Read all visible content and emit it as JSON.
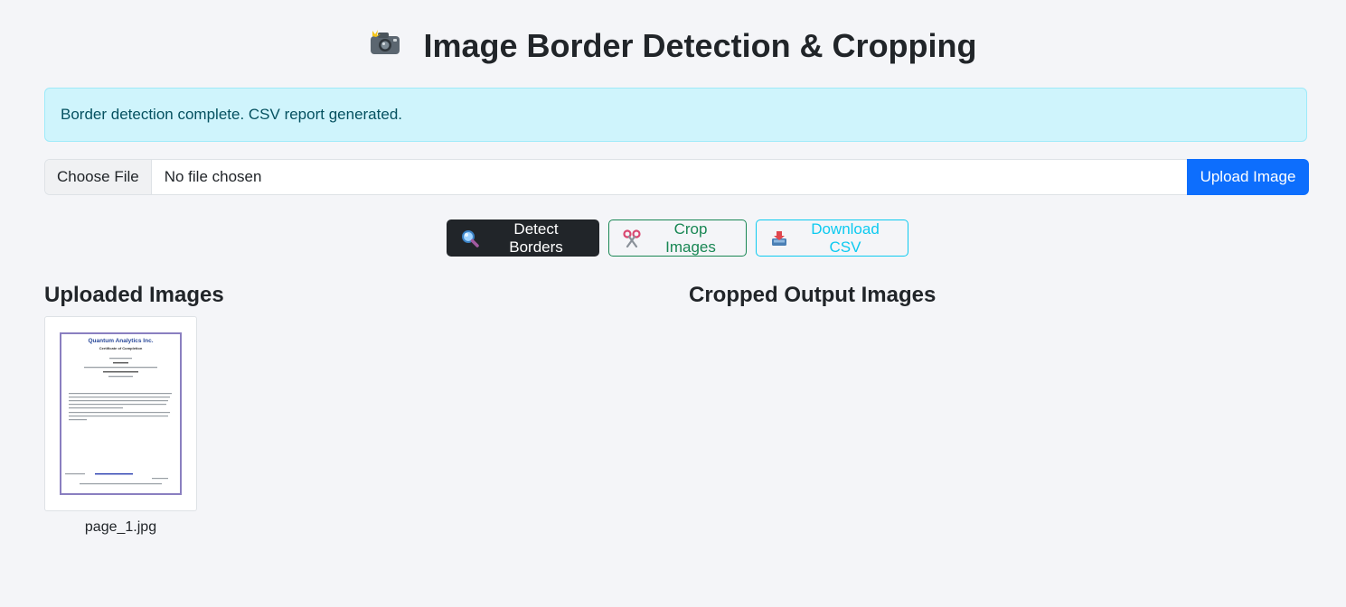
{
  "header": {
    "title": "Image Border Detection & Cropping",
    "icon": "camera-flash-icon"
  },
  "alert": {
    "message": "Border detection complete. CSV report generated.",
    "color": "#cff4fc"
  },
  "upload": {
    "choose_label": "Choose File",
    "file_status": "No file chosen",
    "upload_label": "Upload Image",
    "accent": "#0d6efd"
  },
  "actions": {
    "detect_label": "Detect Borders",
    "detect_icon": "magnifying-glass-icon",
    "crop_label": "Crop Images",
    "crop_icon": "scissors-icon",
    "download_label": "Download CSV",
    "download_icon": "inbox-tray-icon"
  },
  "sections": {
    "uploaded_title": "Uploaded Images",
    "cropped_title": "Cropped Output Images"
  },
  "uploaded_images": [
    {
      "filename": "page_1.jpg",
      "certificate": {
        "company": "Quantum Analytics Inc.",
        "heading": "Certificate of Completion"
      }
    }
  ],
  "cropped_images": []
}
